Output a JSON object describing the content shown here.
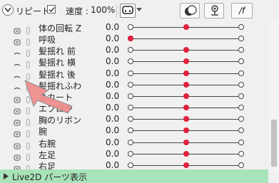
{
  "toolbar": {
    "repeat_label": "リピート",
    "repeat_checked": true,
    "speed_label": "速度 :",
    "speed_value": "100%",
    "fx_label": "/f"
  },
  "params": [
    {
      "name": "体の回転 Z",
      "value": "0.0",
      "level": 0.5
    },
    {
      "name": "呼吸",
      "value": "0.0",
      "level": 0.0
    },
    {
      "name": "髪揺れ 前",
      "value": "0.0",
      "level": 0.5
    },
    {
      "name": "髪揺れ 横",
      "value": "0.0",
      "level": 0.5
    },
    {
      "name": "髪揺れ 後",
      "value": "0.0",
      "level": 0.5
    },
    {
      "name": "髪揺れふわ",
      "value": "0.0",
      "level": 0.5
    },
    {
      "name": "スカート",
      "value": "0.0",
      "level": 0.5
    },
    {
      "name": "エプロン",
      "value": "0.0",
      "level": 0.5
    },
    {
      "name": "胸のリボン",
      "value": "0.0",
      "level": 0.5
    },
    {
      "name": "腕",
      "value": "0.0",
      "level": 0.5
    },
    {
      "name": "右腕",
      "value": "0.0",
      "level": 0.5
    },
    {
      "name": "左足",
      "value": "0.0",
      "level": 0.5
    },
    {
      "name": "右足",
      "value": "0.0",
      "level": 0.5
    }
  ],
  "parts_section": {
    "label": "Live2D パーツ表示"
  },
  "colors": {
    "slider_thumb": "#e0203c",
    "parts_bar": "#a9e3b9",
    "pointer": "#f08c8c"
  }
}
